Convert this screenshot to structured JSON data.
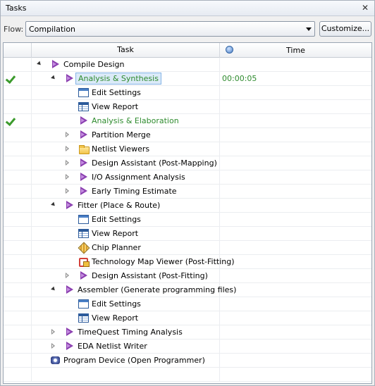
{
  "window": {
    "title": "Tasks",
    "close": "✕"
  },
  "flow": {
    "label": "Flow:",
    "value": "Compilation",
    "customize_label": "Customize..."
  },
  "columns": {
    "task": "Task",
    "time": "Time"
  },
  "rows": [
    {
      "label": "Compile Design",
      "icon": "play-icon",
      "level": 0,
      "expander": "open",
      "status": "",
      "time": ""
    },
    {
      "label": "Analysis & Synthesis",
      "icon": "play-icon",
      "level": 1,
      "expander": "open",
      "status": "done",
      "time": "00:00:05",
      "selected": true,
      "green": true
    },
    {
      "label": "Edit Settings",
      "icon": "edit-icon",
      "level": 2,
      "expander": "",
      "status": "",
      "time": ""
    },
    {
      "label": "View Report",
      "icon": "report-icon",
      "level": 2,
      "expander": "",
      "status": "",
      "time": ""
    },
    {
      "label": "Analysis & Elaboration",
      "icon": "play-icon",
      "level": 2,
      "expander": "",
      "status": "done",
      "time": "",
      "green": true
    },
    {
      "label": "Partition Merge",
      "icon": "play-icon",
      "level": 2,
      "expander": "closed",
      "status": "",
      "time": ""
    },
    {
      "label": "Netlist Viewers",
      "icon": "folder-icon",
      "level": 2,
      "expander": "closed",
      "status": "",
      "time": ""
    },
    {
      "label": "Design Assistant (Post-Mapping)",
      "icon": "play-icon",
      "level": 2,
      "expander": "closed",
      "status": "",
      "time": ""
    },
    {
      "label": "I/O Assignment Analysis",
      "icon": "play-icon",
      "level": 2,
      "expander": "closed",
      "status": "",
      "time": ""
    },
    {
      "label": "Early Timing Estimate",
      "icon": "play-icon",
      "level": 2,
      "expander": "closed",
      "status": "",
      "time": ""
    },
    {
      "label": "Fitter (Place & Route)",
      "icon": "play-icon",
      "level": 1,
      "expander": "open",
      "status": "",
      "time": ""
    },
    {
      "label": "Edit Settings",
      "icon": "edit-icon",
      "level": 2,
      "expander": "",
      "status": "",
      "time": ""
    },
    {
      "label": "View Report",
      "icon": "report-icon",
      "level": 2,
      "expander": "",
      "status": "",
      "time": ""
    },
    {
      "label": "Chip Planner",
      "icon": "chip-icon",
      "level": 2,
      "expander": "",
      "status": "",
      "time": ""
    },
    {
      "label": "Technology Map Viewer (Post-Fitting)",
      "icon": "techmap-icon",
      "level": 2,
      "expander": "",
      "status": "",
      "time": ""
    },
    {
      "label": "Design Assistant (Post-Fitting)",
      "icon": "play-icon",
      "level": 2,
      "expander": "closed",
      "status": "",
      "time": ""
    },
    {
      "label": "Assembler (Generate programming files)",
      "icon": "play-icon",
      "level": 1,
      "expander": "open",
      "status": "",
      "time": ""
    },
    {
      "label": "Edit Settings",
      "icon": "edit-icon",
      "level": 2,
      "expander": "",
      "status": "",
      "time": ""
    },
    {
      "label": "View Report",
      "icon": "report-icon",
      "level": 2,
      "expander": "",
      "status": "",
      "time": ""
    },
    {
      "label": "TimeQuest Timing Analysis",
      "icon": "play-icon",
      "level": 1,
      "expander": "closed",
      "status": "",
      "time": ""
    },
    {
      "label": "EDA Netlist Writer",
      "icon": "play-icon",
      "level": 1,
      "expander": "closed",
      "status": "",
      "time": ""
    },
    {
      "label": "Program Device (Open Programmer)",
      "icon": "program-icon",
      "level": 0,
      "expander": "",
      "status": "",
      "time": ""
    }
  ]
}
